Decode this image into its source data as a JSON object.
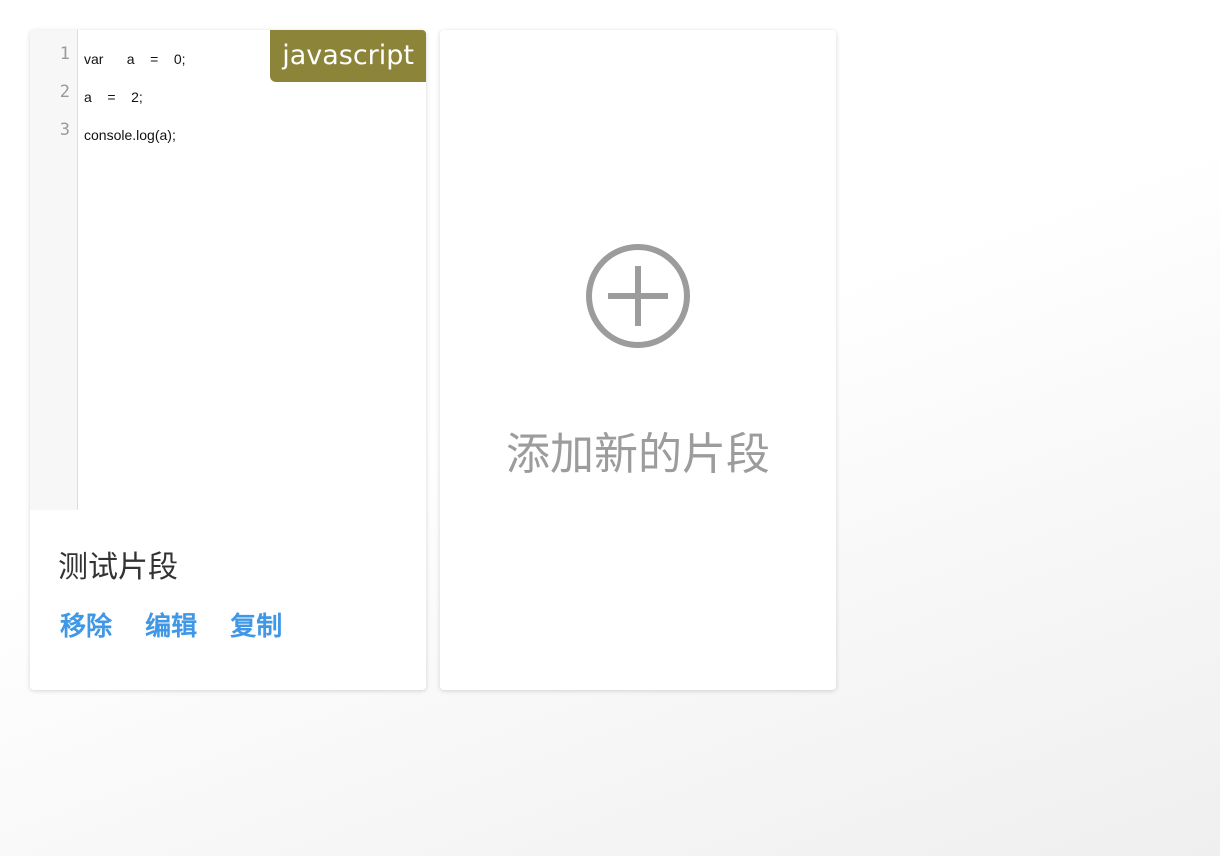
{
  "snippet": {
    "language": "javascript",
    "code_lines": [
      {
        "num": "1",
        "text": "var      a    =    0;"
      },
      {
        "num": "2",
        "text": "a    =    2;"
      },
      {
        "num": "3",
        "text": "console.log(a);"
      }
    ],
    "title": "测试片段",
    "actions": {
      "remove": "移除",
      "edit": "编辑",
      "copy": "复制"
    }
  },
  "add_card": {
    "label": "添加新的片段",
    "icon": "plus-circle-icon"
  },
  "colors": {
    "badge": "#8c8438",
    "link": "#3f97e6",
    "muted": "#9c9c9c"
  }
}
